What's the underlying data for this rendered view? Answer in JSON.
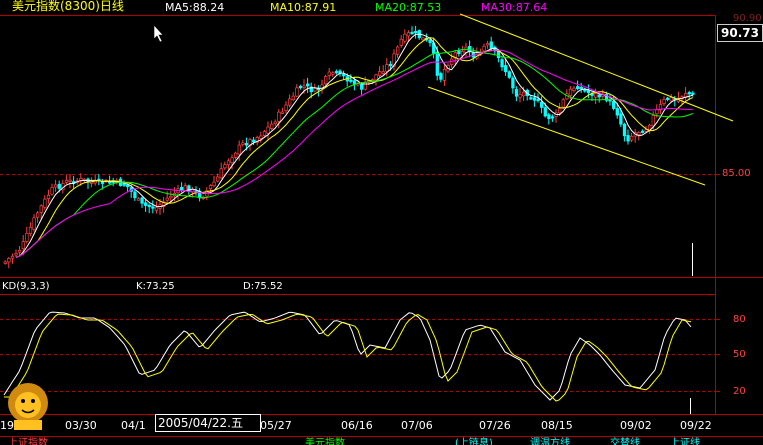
{
  "header": {
    "title": "美元指数(8300)日线",
    "ma5": "MA5:88.24",
    "ma10": "MA10:87.91",
    "ma20": "MA20:87.53",
    "ma30": "MA30:87.64",
    "current_price": "90.73",
    "top_partial": "90.90"
  },
  "colors": {
    "up": "#ff4040",
    "down": "#00ffff",
    "ma5": "#ffffff",
    "ma10": "#ffff00",
    "ma20": "#00ff00",
    "ma30": "#ff00ff",
    "channel": "#ffff00"
  },
  "price_axis": {
    "label_85": "85.00"
  },
  "kd": {
    "title": "KD(9,3,3)",
    "k_value": "K:73.25",
    "d_value": "D:75.52",
    "levels": [
      "80",
      "50",
      "20"
    ]
  },
  "x_axis": {
    "dates": [
      "03/30",
      "04/1",
      "05/27",
      "06/16",
      "07/06",
      "07/26",
      "08/15",
      "09/02",
      "09/22"
    ],
    "left_partial": "19",
    "cursor_date": "2005/04/22.五"
  },
  "logo_icon": "lion-mascot-icon",
  "status_bar": {
    "items": [
      "上证指数",
      "美元指数",
      "(上链息)",
      "调温方线",
      "交替线",
      "上证线"
    ]
  },
  "chart_data": {
    "type": "candlestick",
    "title": "美元指数(8300)日线",
    "series": [
      {
        "name": "MA5",
        "last": 88.24
      },
      {
        "name": "MA10",
        "last": 87.91
      },
      {
        "name": "MA20",
        "last": 87.53
      },
      {
        "name": "MA30",
        "last": 87.64
      }
    ],
    "price_labels": [
      85.0,
      90.73
    ],
    "kd": {
      "k": 73.25,
      "d": 75.52,
      "levels": [
        20,
        50,
        80
      ]
    },
    "x_ticks": [
      "03/30",
      "04/1",
      "05/27",
      "06/16",
      "07/06",
      "07/26",
      "08/15",
      "09/02",
      "09/22"
    ]
  }
}
